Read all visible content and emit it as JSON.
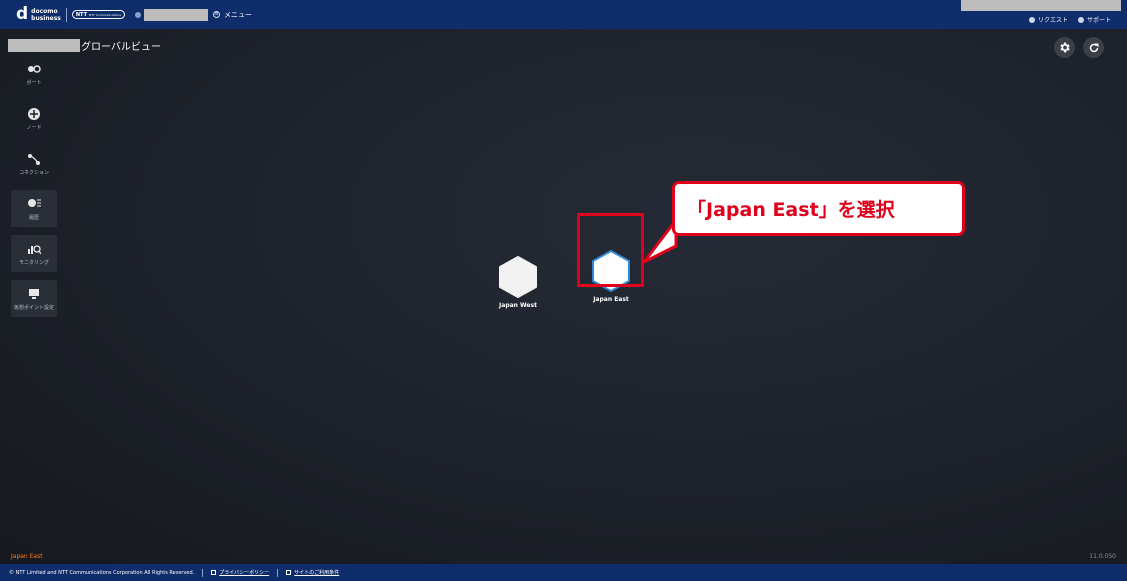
{
  "header": {
    "logo_top": "docomo",
    "logo_bottom": "business",
    "ntt_label": "NTT Communications",
    "menu_label": "メニュー",
    "request_label": "リクエスト",
    "support_label": "サポート"
  },
  "main": {
    "page_title": "グローバルビュー",
    "settings_icon": "gear-icon",
    "refresh_icon": "refresh-icon"
  },
  "sidebar": {
    "items": [
      {
        "label": "ポート",
        "icon": "port-icon"
      },
      {
        "label": "ノード",
        "icon": "node-icon"
      },
      {
        "label": "コネクション",
        "icon": "connection-icon"
      },
      {
        "label": "履歴",
        "icon": "history-icon"
      },
      {
        "label": "モニタリング",
        "icon": "monitoring-icon"
      },
      {
        "label": "仮想ポイント設定",
        "icon": "monitor-icon"
      }
    ]
  },
  "regions": [
    {
      "label": "Japan West"
    },
    {
      "label": "Japan East"
    }
  ],
  "callout": {
    "text": "「Japan East」を選択",
    "accent": "#e0001b"
  },
  "status": {
    "selected_region": "Japan East",
    "version": "11.0.050"
  },
  "footer": {
    "copyright": "© NTT Limited and NTT Communications Corporation All Rights Reserved.",
    "privacy_link": "プライバシーポリシー",
    "terms_link": "サイトのご利用条件"
  },
  "colors": {
    "header_bg": "#0f2d6b",
    "canvas_bg": "#1c1f26",
    "highlight": "#e0001b",
    "status_text": "#ff7a1a"
  }
}
